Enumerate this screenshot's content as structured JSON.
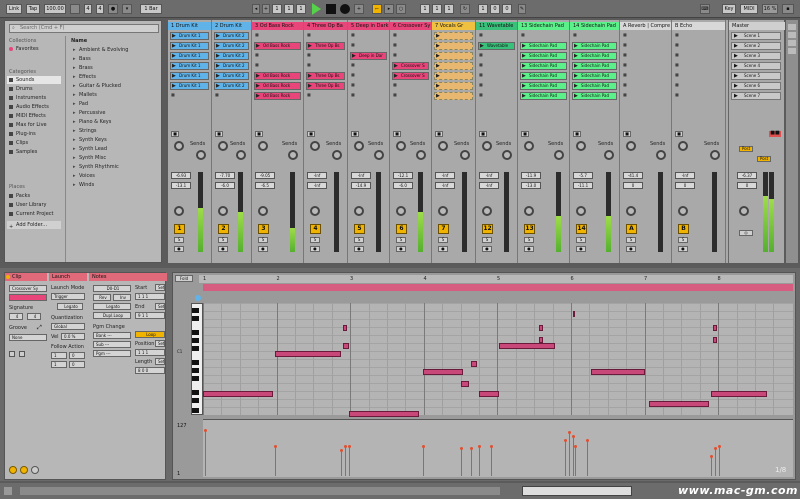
{
  "topbar": {
    "link": "Link",
    "tap": "Tap",
    "tempo": "100.00",
    "sig_num": "4",
    "sig_den": "4",
    "quant": "1 Bar",
    "pos1": "1",
    "pos2": "1",
    "pos3": "1",
    "len1": "1",
    "len2": "0",
    "len3": "0",
    "key": "Key",
    "midi": "MIDI",
    "cpu": "16 %"
  },
  "browser": {
    "search_placeholder": "Search (Cmd + F)",
    "collections_label": "Collections",
    "favorites": "Favorites",
    "categories_label": "Categories",
    "categories": [
      "Sounds",
      "Drums",
      "Instruments",
      "Audio Effects",
      "MIDI Effects",
      "Max for Live",
      "Plug-ins",
      "Clips",
      "Samples"
    ],
    "places_label": "Places",
    "places": [
      "Packs",
      "User Library",
      "Current Project",
      "Add Folder..."
    ],
    "column_header": "Name",
    "items": [
      "Ambient & Evolving",
      "Bass",
      "Brass",
      "Effects",
      "Guitar & Plucked",
      "Mallets",
      "Pad",
      "Percussive",
      "Piano & Keys",
      "Strings",
      "Synth Keys",
      "Synth Lead",
      "Synth Misc",
      "Synth Rhythmic",
      "Voices",
      "Winds"
    ]
  },
  "tracks": [
    {
      "name": "1 Drum Kit",
      "color": "#5fb3e8",
      "clips": [
        "Drum Kit 1",
        "Drum Kit 1",
        "Drum Kit 1",
        "Drum Kit 1",
        "Drum Kit 1",
        "Drum Kit 1",
        ""
      ],
      "vol": "-6.93",
      "pan": "-13.1",
      "num": "1",
      "level": 0.55
    },
    {
      "name": "2 Drum Kit",
      "color": "#5fb3e8",
      "clips": [
        "Drum Kit 2",
        "Drum Kit 2",
        "Drum Kit 2",
        "Drum Kit 2",
        "Drum Kit 2",
        "Drum Kit 2",
        ""
      ],
      "vol": "-7.70",
      "pan": "-6.0",
      "num": "2",
      "level": 0.5
    },
    {
      "name": "3 Od Bass Rock",
      "color": "#e8457a",
      "clips": [
        "",
        "Od Bass Rock",
        "",
        "",
        "Od Bass Rock",
        "Od Bass Rock",
        "Od Bass Rock"
      ],
      "vol": "-9.05",
      "pan": "-6.5",
      "num": "3",
      "level": 0.3
    },
    {
      "name": "4 Three Op Ba",
      "color": "#e8457a",
      "clips": [
        "",
        "Three Op Bs",
        "",
        "",
        "Three Op Bs",
        "Three Op Bs",
        ""
      ],
      "vol": "-Inf",
      "pan": "-Inf",
      "num": "4",
      "level": 0.0
    },
    {
      "name": "5 Deep in Dark",
      "color": "#e8457a",
      "clips": [
        "",
        "",
        "Deep in Dar",
        "",
        "",
        "",
        ""
      ],
      "vol": "-Inf",
      "pan": "-14.9",
      "num": "5",
      "level": 0.0
    },
    {
      "name": "6 Crossover Sy",
      "color": "#e8457a",
      "clips": [
        "",
        "",
        "",
        "Crossover S",
        "Crossover S",
        "",
        ""
      ],
      "vol": "-12.1",
      "pan": "-6.0",
      "num": "6",
      "level": 0.5
    },
    {
      "name": "7 Vocals Gr",
      "color": "#f0c040",
      "clips": [
        "",
        "",
        "",
        "",
        "",
        "",
        ""
      ],
      "vol": "-Inf",
      "pan": "-Inf",
      "num": "7",
      "level": 0.0
    },
    {
      "name": "11 Wavetable",
      "color": "#39c07a",
      "clips": [
        "",
        "Wavetable",
        "",
        "",
        "",
        "",
        ""
      ],
      "vol": "-Inf",
      "pan": "-Inf",
      "num": "12",
      "level": 0.0
    },
    {
      "name": "13 Sidechain Pad",
      "color": "#5cf08a",
      "clips": [
        "",
        "Sidechain Pad",
        "Sidechain Pad",
        "Sidechain Pad",
        "Sidechain Pad",
        "Sidechain Pad",
        "Sidechain Pad"
      ],
      "vol": "-11.9",
      "pan": "-13.0",
      "num": "13",
      "level": 0.45
    },
    {
      "name": "14 Sidechain Pad",
      "color": "#5cf08a",
      "clips": [
        "",
        "Sidechain Pad",
        "Sidechain Pad",
        "Sidechain Pad",
        "Sidechain Pad",
        "Sidechain Pad",
        "Sidechain Pad"
      ],
      "vol": "-5.7",
      "pan": "-11.1",
      "num": "14",
      "level": 0.45
    },
    {
      "name": "A Reverb | Compre",
      "color": "#d8d8d8",
      "clips": [
        "",
        "",
        "",
        "",
        "",
        "",
        ""
      ],
      "vol": "-41.4",
      "pan": "0",
      "num": "A",
      "level": 0.0
    },
    {
      "name": "B Echo",
      "color": "#d8d8d8",
      "clips": [
        "",
        "",
        "",
        "",
        "",
        "",
        ""
      ],
      "vol": "-Inf",
      "pan": "0",
      "num": "B",
      "level": 0.0
    }
  ],
  "master": {
    "name": "Master",
    "scenes": [
      "Scene 1",
      "Scene 2",
      "Scene 3",
      "Scene 4",
      "Scene 5",
      "Scene 6",
      "Scene 7"
    ],
    "vol": "-6.37",
    "pan": "0",
    "post": "Post",
    "level": 0.7
  },
  "sends_label": "Sends",
  "clip": {
    "header": "Clip",
    "name": "Crossover Sy",
    "signature_label": "Signature",
    "sig_num": "4",
    "sig_den": "4",
    "groove_label": "Groove",
    "groove_value": "None",
    "launch_header": "Launch",
    "launch_mode_label": "Launch Mode",
    "launch_mode": "Trigger",
    "legato": "Legato",
    "quant_label": "Quantization",
    "quant_value": "Global",
    "vel_label": "Vel",
    "vel_value": "0.0 %",
    "follow_label": "Follow Action",
    "notes_header": "Notes",
    "notes_val": "D0-D1",
    "rev": "Rev",
    "inv": "Inv",
    "dupl": "Dupl.Loop",
    "pgm_label": "Pgm Change",
    "bank": "Bank ---",
    "sub": "Sub ---",
    "pgm": "Pgm ---",
    "start_label": "Start",
    "end_label": "End",
    "loop_btn": "Loop",
    "position_label": "Position",
    "length_label": "Length",
    "set": "Set"
  },
  "editor": {
    "fold": "Fold",
    "bars": [
      "1",
      "2",
      "3",
      "4",
      "5",
      "6",
      "7",
      "8"
    ],
    "note_label": "C1",
    "vel_max": "127",
    "vel_min": "1",
    "page": "1/8"
  },
  "watermark": "www.mac-gm.com"
}
